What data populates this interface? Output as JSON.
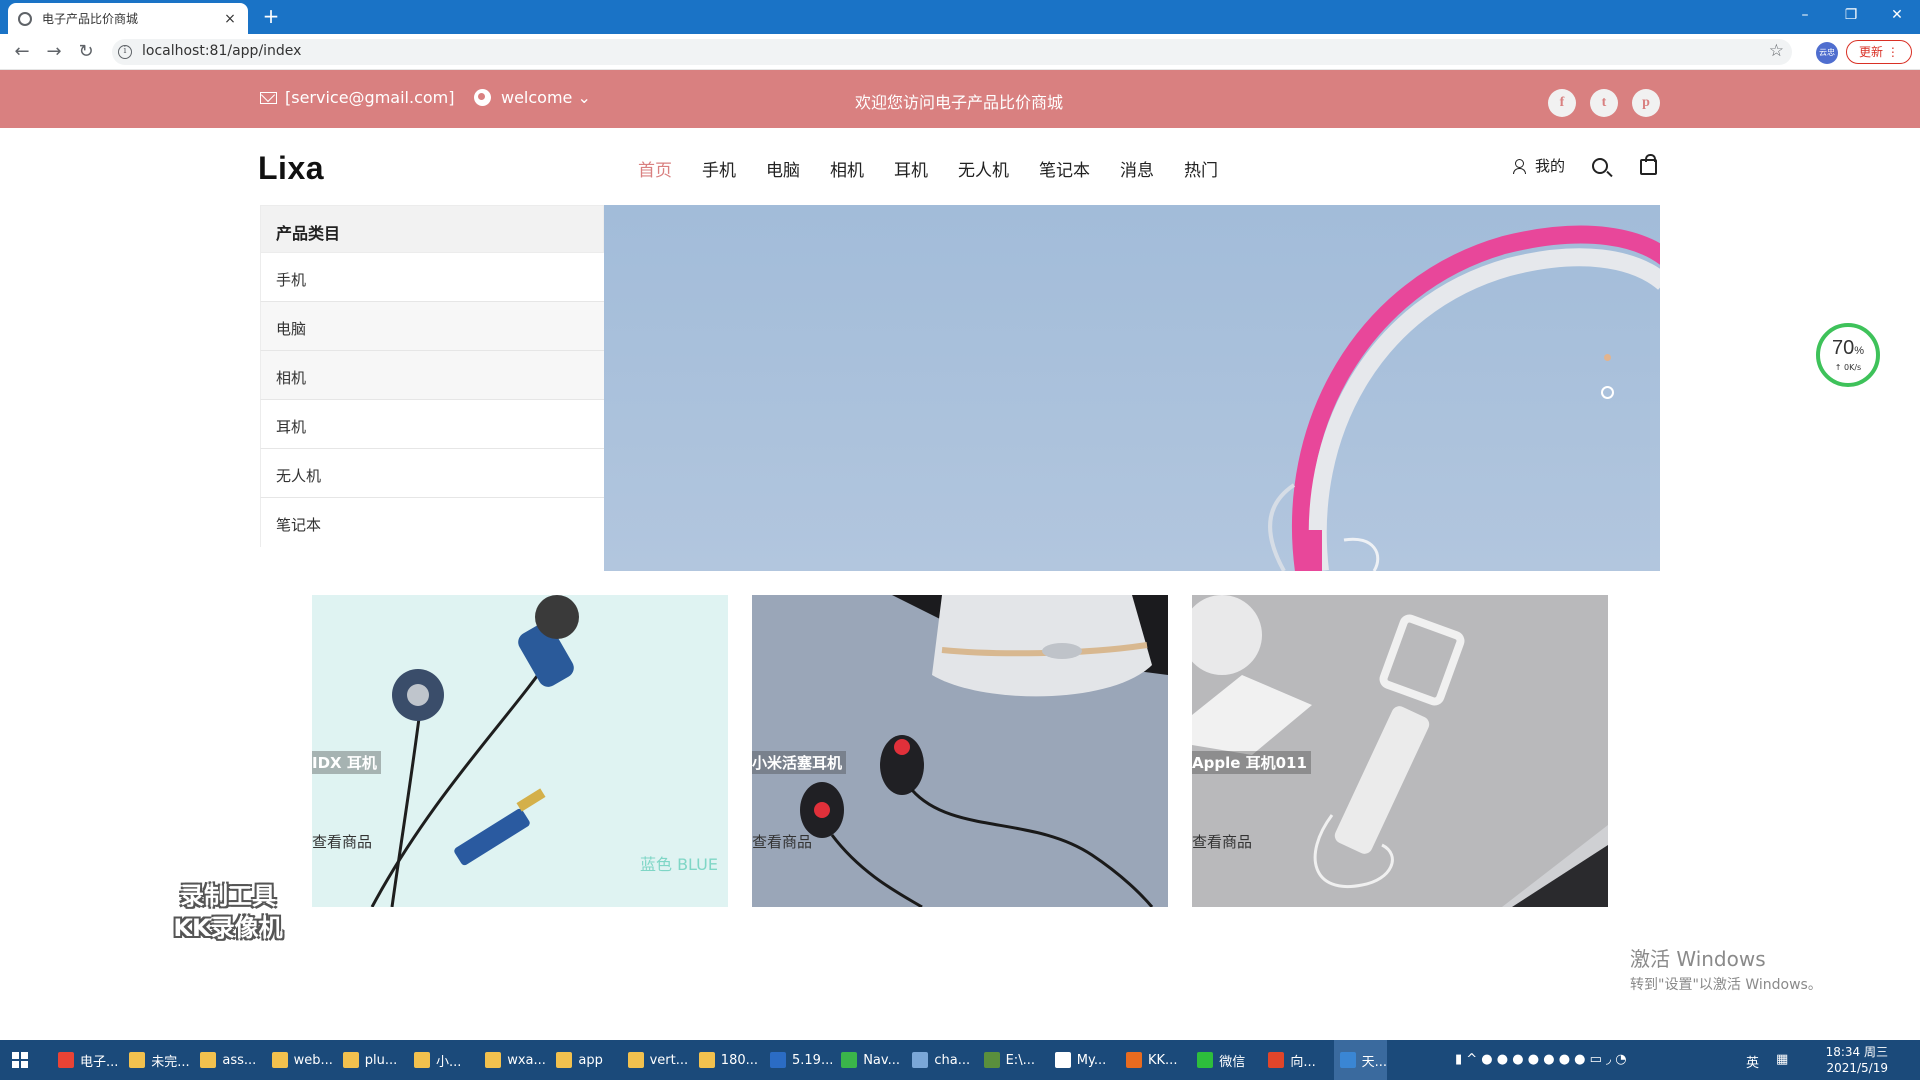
{
  "browser": {
    "tab_title": "电子产品比价商城",
    "tab_close": "×",
    "new_tab": "+",
    "url": "localhost:81/app/index",
    "ext_label": "云忠",
    "update_label": "更新 ⋮",
    "window_controls": [
      "–",
      "❐",
      "✕"
    ]
  },
  "topbar": {
    "email": "[service@gmail.com]",
    "welcome": "welcome ⌄",
    "marquee": "欢迎您访问电子产品比价商城",
    "social": [
      "f",
      "t",
      "p"
    ]
  },
  "header": {
    "logo": "Lixa",
    "nav": [
      {
        "label": "首页",
        "active": true
      },
      {
        "label": "手机"
      },
      {
        "label": "电脑"
      },
      {
        "label": "相机"
      },
      {
        "label": "耳机"
      },
      {
        "label": "无人机"
      },
      {
        "label": "笔记本"
      },
      {
        "label": "消息"
      },
      {
        "label": "热门"
      }
    ],
    "account_label": "我的"
  },
  "category": {
    "title": "产品类目",
    "items": [
      "手机",
      "电脑",
      "相机",
      "耳机",
      "无人机",
      "笔记本"
    ]
  },
  "products": [
    {
      "title": "IDX 耳机",
      "link": "查看商品",
      "watermark": "蓝色 BLUE"
    },
    {
      "title": "小米活塞耳机",
      "link": "查看商品"
    },
    {
      "title": "Apple 耳机011",
      "link": "查看商品"
    }
  ],
  "overlays": {
    "speed_percent": "70",
    "speed_unit": "%",
    "speed_rate": "↑ 0K/s",
    "recorder_line1": "录制工具",
    "recorder_line2": "KK录像机",
    "activate_line1": "激活 Windows",
    "activate_line2": "转到\"设置\"以激活 Windows。"
  },
  "taskbar": {
    "items": [
      "电子...",
      "未完...",
      "ass...",
      "web...",
      "plu...",
      "小...",
      "wxa...",
      "app",
      "vert...",
      "180...",
      "5.19...",
      "Nav...",
      "cha...",
      "E:\\...",
      "My...",
      "KK...",
      "微信",
      "向...",
      "天..."
    ],
    "ime": "英",
    "time": "18:34 周三",
    "date": "2021/5/19"
  },
  "colors": {
    "accent": "#d98080",
    "browser_blue": "#1a73c6",
    "banner_bg": "#a8c0dc",
    "headphone_pink": "#e8479a"
  }
}
